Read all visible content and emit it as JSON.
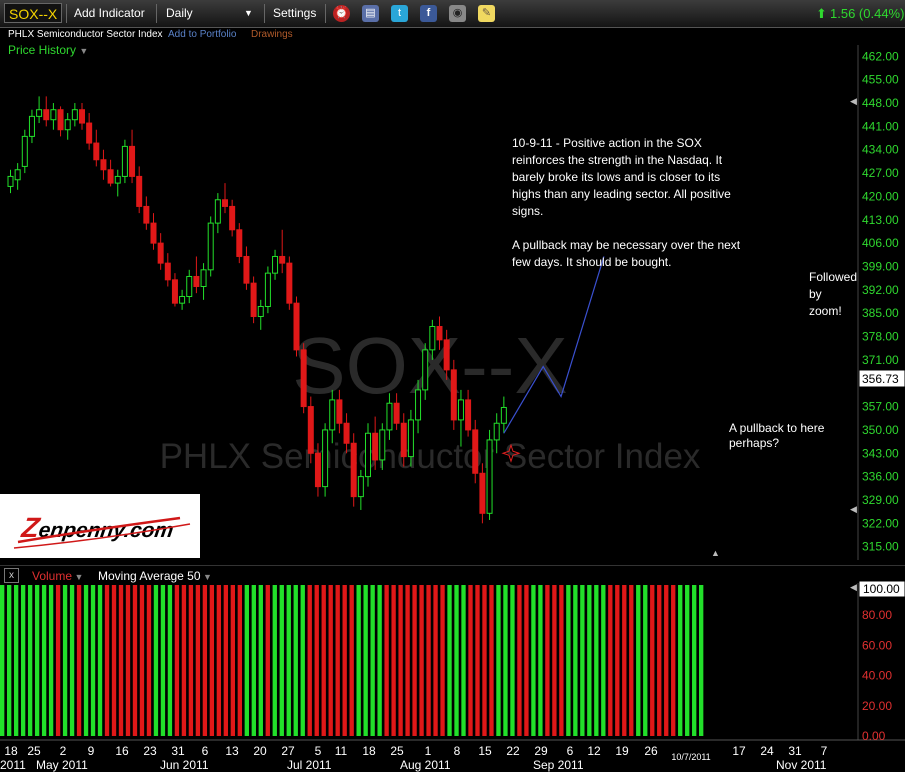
{
  "toolbar": {
    "symbol": "SOX--X",
    "add_indicator": "Add Indicator",
    "interval": "Daily",
    "settings": "Settings",
    "change": "1.56 (0.44%)",
    "icons": [
      "alarm-clock-icon",
      "print-icon",
      "twitter-icon",
      "facebook-icon",
      "camera-icon",
      "note-icon"
    ]
  },
  "subheader": {
    "name": "PHLX Semiconductor Sector Index",
    "add_portfolio": "Add to Portfolio",
    "drawings": "Drawings"
  },
  "price_history_label": "Price History",
  "watermark": {
    "symbol": "SOX--X",
    "name": "PHLX Semiconductor Sector Index"
  },
  "logo": {
    "text": "enpenny.com",
    "z": "Z"
  },
  "annotations": {
    "main": [
      "10-9-11 - Positive action in the SOX",
      "reinforces the strength in the Nasdaq. It",
      "barely broke its lows and is closer to its",
      "highs than any leading sector. All positive",
      "signs.",
      "",
      "A pullback may be necessary over the next",
      "few days. It should be bought."
    ],
    "zoom": [
      "Followed",
      "by",
      "zoom!"
    ],
    "pullback": [
      "A pullback to here",
      "perhaps?"
    ]
  },
  "volume_panel": {
    "label": "Volume",
    "ma_label": "Moving Average 50"
  },
  "colors": {
    "up": "#22e02a",
    "down": "#e01818",
    "axis_text": "#2fd82f",
    "accent": "#f5d400",
    "drawing": "#3a50d0"
  },
  "chart_data": {
    "type": "candlestick",
    "title": "",
    "current_price": "356.73",
    "y_ticks": [
      "462.00",
      "455.00",
      "448.00",
      "441.00",
      "434.00",
      "427.00",
      "420.00",
      "413.00",
      "406.00",
      "399.00",
      "392.00",
      "385.00",
      "378.00",
      "371.00",
      "364.00",
      "357.00",
      "350.00",
      "343.00",
      "336.00",
      "329.00",
      "322.00",
      "315.00"
    ],
    "ylim": [
      311,
      466
    ],
    "x_ticks": [
      "18",
      "25",
      "2",
      "9",
      "16",
      "23",
      "31",
      "6",
      "13",
      "20",
      "27",
      "5",
      "11",
      "18",
      "25",
      "1",
      "8",
      "15",
      "22",
      "29",
      "6",
      "12",
      "19",
      "26",
      "10/7/2011",
      "17",
      "24",
      "31",
      "7"
    ],
    "months": [
      "2011",
      "May 2011",
      "Jun 2011",
      "Jul 2011",
      "Aug 2011",
      "Sep 2011",
      "Nov 2011"
    ],
    "candles": [
      {
        "o": 423,
        "h": 428,
        "l": 421,
        "c": 426
      },
      {
        "o": 425,
        "h": 430,
        "l": 422,
        "c": 428
      },
      {
        "o": 429,
        "h": 440,
        "l": 427,
        "c": 438
      },
      {
        "o": 438,
        "h": 446,
        "l": 436,
        "c": 444
      },
      {
        "o": 444,
        "h": 450,
        "l": 442,
        "c": 446
      },
      {
        "o": 446,
        "h": 450,
        "l": 441,
        "c": 443
      },
      {
        "o": 443,
        "h": 448,
        "l": 440,
        "c": 446
      },
      {
        "o": 446,
        "h": 447,
        "l": 438,
        "c": 440
      },
      {
        "o": 440,
        "h": 445,
        "l": 437,
        "c": 443
      },
      {
        "o": 443,
        "h": 448,
        "l": 441,
        "c": 446
      },
      {
        "o": 446,
        "h": 448,
        "l": 440,
        "c": 442
      },
      {
        "o": 442,
        "h": 445,
        "l": 434,
        "c": 436
      },
      {
        "o": 436,
        "h": 440,
        "l": 429,
        "c": 431
      },
      {
        "o": 431,
        "h": 434,
        "l": 425,
        "c": 428
      },
      {
        "o": 428,
        "h": 431,
        "l": 423,
        "c": 424
      },
      {
        "o": 424,
        "h": 428,
        "l": 420,
        "c": 426
      },
      {
        "o": 426,
        "h": 437,
        "l": 424,
        "c": 435
      },
      {
        "o": 435,
        "h": 440,
        "l": 424,
        "c": 426
      },
      {
        "o": 426,
        "h": 429,
        "l": 415,
        "c": 417
      },
      {
        "o": 417,
        "h": 420,
        "l": 410,
        "c": 412
      },
      {
        "o": 412,
        "h": 415,
        "l": 404,
        "c": 406
      },
      {
        "o": 406,
        "h": 409,
        "l": 398,
        "c": 400
      },
      {
        "o": 400,
        "h": 403,
        "l": 393,
        "c": 395
      },
      {
        "o": 395,
        "h": 397,
        "l": 387,
        "c": 388
      },
      {
        "o": 388,
        "h": 392,
        "l": 386,
        "c": 390
      },
      {
        "o": 390,
        "h": 398,
        "l": 388,
        "c": 396
      },
      {
        "o": 396,
        "h": 402,
        "l": 391,
        "c": 393
      },
      {
        "o": 393,
        "h": 400,
        "l": 389,
        "c": 398
      },
      {
        "o": 398,
        "h": 414,
        "l": 396,
        "c": 412
      },
      {
        "o": 412,
        "h": 421,
        "l": 409,
        "c": 419
      },
      {
        "o": 419,
        "h": 424,
        "l": 415,
        "c": 417
      },
      {
        "o": 417,
        "h": 419,
        "l": 408,
        "c": 410
      },
      {
        "o": 410,
        "h": 412,
        "l": 400,
        "c": 402
      },
      {
        "o": 402,
        "h": 405,
        "l": 392,
        "c": 394
      },
      {
        "o": 394,
        "h": 396,
        "l": 382,
        "c": 384
      },
      {
        "o": 384,
        "h": 389,
        "l": 380,
        "c": 387
      },
      {
        "o": 387,
        "h": 399,
        "l": 385,
        "c": 397
      },
      {
        "o": 397,
        "h": 404,
        "l": 395,
        "c": 402
      },
      {
        "o": 402,
        "h": 410,
        "l": 397,
        "c": 400
      },
      {
        "o": 400,
        "h": 402,
        "l": 386,
        "c": 388
      },
      {
        "o": 388,
        "h": 390,
        "l": 372,
        "c": 374
      },
      {
        "o": 374,
        "h": 376,
        "l": 355,
        "c": 357
      },
      {
        "o": 357,
        "h": 360,
        "l": 340,
        "c": 343
      },
      {
        "o": 343,
        "h": 346,
        "l": 330,
        "c": 333
      },
      {
        "o": 333,
        "h": 352,
        "l": 330,
        "c": 350
      },
      {
        "o": 350,
        "h": 362,
        "l": 346,
        "c": 359
      },
      {
        "o": 359,
        "h": 362,
        "l": 349,
        "c": 352
      },
      {
        "o": 352,
        "h": 355,
        "l": 343,
        "c": 346
      },
      {
        "o": 346,
        "h": 349,
        "l": 327,
        "c": 330
      },
      {
        "o": 330,
        "h": 338,
        "l": 326,
        "c": 336
      },
      {
        "o": 336,
        "h": 352,
        "l": 333,
        "c": 349
      },
      {
        "o": 349,
        "h": 354,
        "l": 338,
        "c": 341
      },
      {
        "o": 341,
        "h": 352,
        "l": 338,
        "c": 350
      },
      {
        "o": 350,
        "h": 361,
        "l": 347,
        "c": 358
      },
      {
        "o": 358,
        "h": 361,
        "l": 350,
        "c": 352
      },
      {
        "o": 352,
        "h": 355,
        "l": 339,
        "c": 342
      },
      {
        "o": 342,
        "h": 356,
        "l": 339,
        "c": 353
      },
      {
        "o": 353,
        "h": 365,
        "l": 349,
        "c": 362
      },
      {
        "o": 362,
        "h": 376,
        "l": 359,
        "c": 374
      },
      {
        "o": 374,
        "h": 383,
        "l": 371,
        "c": 381
      },
      {
        "o": 381,
        "h": 384,
        "l": 374,
        "c": 377
      },
      {
        "o": 377,
        "h": 380,
        "l": 365,
        "c": 368
      },
      {
        "o": 368,
        "h": 371,
        "l": 350,
        "c": 353
      },
      {
        "o": 353,
        "h": 362,
        "l": 345,
        "c": 359
      },
      {
        "o": 359,
        "h": 362,
        "l": 348,
        "c": 350
      },
      {
        "o": 350,
        "h": 353,
        "l": 334,
        "c": 337
      },
      {
        "o": 337,
        "h": 340,
        "l": 322,
        "c": 325
      },
      {
        "o": 325,
        "h": 350,
        "l": 323,
        "c": 347
      },
      {
        "o": 347,
        "h": 355,
        "l": 343,
        "c": 352
      },
      {
        "o": 352,
        "h": 360,
        "l": 349,
        "c": 356.73
      }
    ],
    "drawing_line": [
      {
        "i": 69,
        "v": 349
      },
      {
        "i": 74.5,
        "v": 369
      },
      {
        "i": 77,
        "v": 360
      },
      {
        "i": 83,
        "v": 402
      }
    ],
    "pullback_marker": {
      "i": 70,
      "v": 343
    },
    "volume": {
      "ylim": [
        0,
        100
      ],
      "ticks": [
        "100.00",
        "80.00",
        "60.00",
        "40.00",
        "20.00",
        "0.00"
      ],
      "current": "100.00"
    }
  }
}
